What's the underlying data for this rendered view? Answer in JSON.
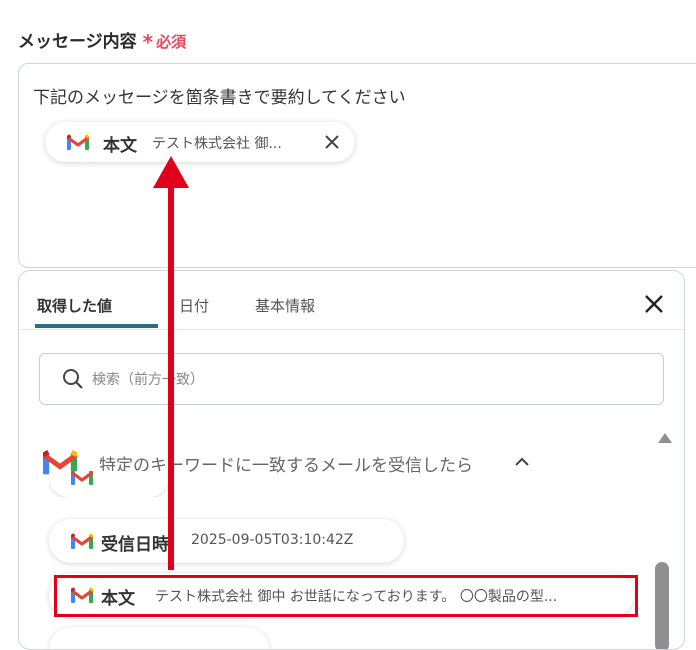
{
  "field": {
    "label": "メッセージ内容",
    "required": "必須"
  },
  "textarea": {
    "text": "下記のメッセージを箇条書きで要約してください",
    "chip": {
      "title": "本文",
      "value": "テスト株式会社 御..."
    }
  },
  "panel": {
    "tabs": [
      {
        "label": "取得した値"
      },
      {
        "label": "日付"
      },
      {
        "label": "基本情報"
      }
    ],
    "search_placeholder": "検索（前方一致）",
    "group_title": "特定のキーワードに一致するメールを受信したら",
    "items": [
      {
        "title": "受信日時",
        "value": "2025-09-05T03:10:42Z"
      },
      {
        "title": "本文",
        "value": "テスト株式会社 御中 お世話になっております。 〇〇製品の型..."
      }
    ]
  },
  "colors": {
    "required": "#e8475f",
    "tab_underline": "#2a6f7f",
    "highlight": "#e0001a",
    "arrow": "#e0001a"
  },
  "icons": [
    "gmail-icon",
    "close-icon",
    "search-icon",
    "chevron-up-icon",
    "scroll-up-icon"
  ]
}
